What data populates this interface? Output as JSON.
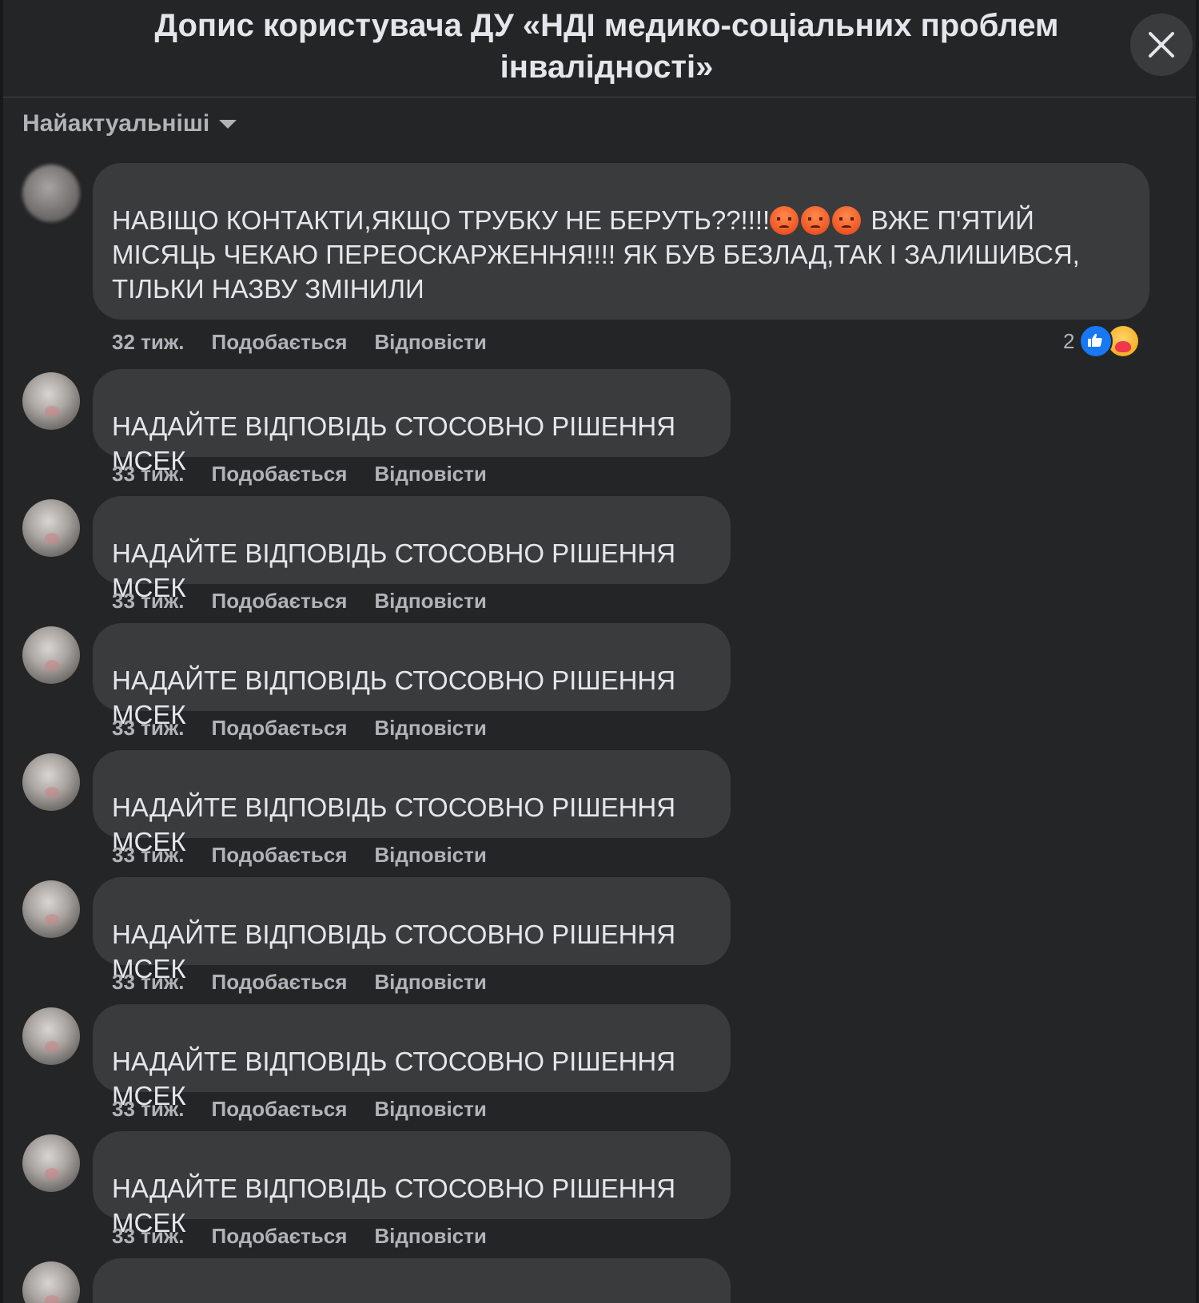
{
  "dialog": {
    "title": "Допис користувача ДУ «НДІ медико-соціальних проблем інвалідності»",
    "close_icon": "close-icon"
  },
  "sort": {
    "label": "Найактуальніші",
    "icon": "caret-down-icon"
  },
  "comments": [
    {
      "text_part1": "НАВІЩО КОНТАКТИ,ЯКЩО ТРУБКУ НЕ БЕРУТЬ??!!!!",
      "emojis": [
        "angry-emoji",
        "angry-emoji",
        "angry-emoji"
      ],
      "text_part2": " ВЖЕ П'ЯТИЙ МІСЯЦЬ ЧЕКАЮ ПЕРЕОСКАРЖЕННЯ!!!! ЯК БУВ БЕЗЛАД,ТАК І ЗАЛИШИВСЯ, ТІЛЬКИ НАЗВУ ЗМІНИЛИ",
      "time": "32 тиж.",
      "like_label": "Подобається",
      "reply_label": "Відповісти",
      "reactions": {
        "count": "2",
        "types": [
          "like",
          "care"
        ]
      }
    },
    {
      "text": "НАДАЙТЕ ВІДПОВІДЬ СТОСОВНО РІШЕННЯ МСЕК",
      "time": "33 тиж.",
      "like_label": "Подобається",
      "reply_label": "Відповісти"
    },
    {
      "text": "НАДАЙТЕ ВІДПОВІДЬ СТОСОВНО РІШЕННЯ МСЕК",
      "time": "33 тиж.",
      "like_label": "Подобається",
      "reply_label": "Відповісти"
    },
    {
      "text": "НАДАЙТЕ ВІДПОВІДЬ СТОСОВНО РІШЕННЯ МСЕК",
      "time": "33 тиж.",
      "like_label": "Подобається",
      "reply_label": "Відповісти"
    },
    {
      "text": "НАДАЙТЕ ВІДПОВІДЬ СТОСОВНО РІШЕННЯ МСЕК",
      "time": "33 тиж.",
      "like_label": "Подобається",
      "reply_label": "Відповісти"
    },
    {
      "text": "НАДАЙТЕ ВІДПОВІДЬ СТОСОВНО РІШЕННЯ МСЕК",
      "time": "33 тиж.",
      "like_label": "Подобається",
      "reply_label": "Відповісти"
    },
    {
      "text": "НАДАЙТЕ ВІДПОВІДЬ СТОСОВНО РІШЕННЯ МСЕК",
      "time": "33 тиж.",
      "like_label": "Подобається",
      "reply_label": "Відповісти"
    },
    {
      "text": "НАДАЙТЕ ВІДПОВІДЬ СТОСОВНО РІШЕННЯ МСЕК",
      "time": "33 тиж.",
      "like_label": "Подобається",
      "reply_label": "Відповісти"
    }
  ],
  "colors": {
    "background": "#242526",
    "bubble": "#3a3b3c",
    "text": "#e4e6eb",
    "secondary_text": "#b0b3b8",
    "like_blue": "#1877f2"
  }
}
